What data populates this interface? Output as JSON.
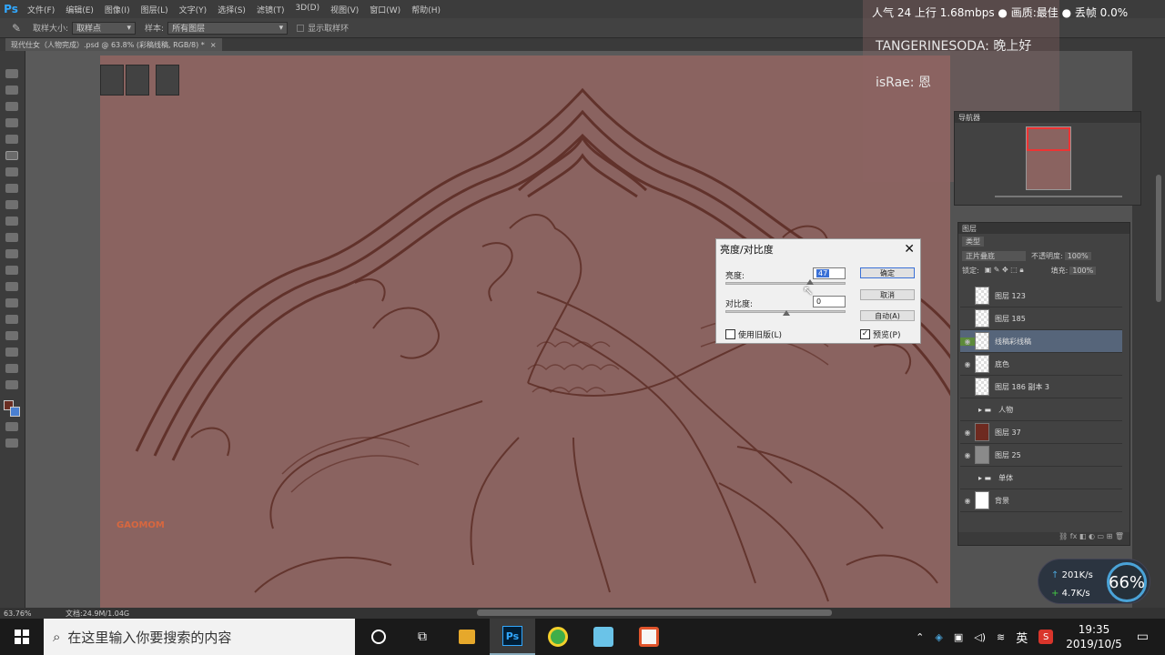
{
  "app": {
    "logo": "Ps"
  },
  "menu": [
    "文件(F)",
    "编辑(E)",
    "图像(I)",
    "图层(L)",
    "文字(Y)",
    "选择(S)",
    "滤镜(T)",
    "3D(D)",
    "视图(V)",
    "窗口(W)",
    "帮助(H)"
  ],
  "options": {
    "size_label": "取样大小:",
    "size_value": "取样点",
    "sample_label": "样本:",
    "sample_value": "所有图层",
    "ring_label": "显示取样环"
  },
  "doc_tab": "现代仕女（人物完成）.psd @ 63.8% (彩稿线稿, RGB/8) *",
  "stream": {
    "top": "人气 24    上行 1.68mbps  ● 画质:最佳  ● 丢帧 0.0%",
    "chats": [
      {
        "user": "TANGERINESODA:",
        "text": "晚上好"
      },
      {
        "user": "isRae:",
        "text": "恩"
      }
    ]
  },
  "navigator": {
    "title": "导航器"
  },
  "layers_panel": {
    "title": "图层",
    "filter": "类型",
    "blend": "正片叠底",
    "opacity_label": "不透明度:",
    "opacity": "100%",
    "lock_label": "锁定:",
    "fill_label": "填充:",
    "fill": "100%",
    "layers": [
      {
        "name": "图层 123",
        "visible": false,
        "selected": false,
        "type": "layer"
      },
      {
        "name": "图层 185",
        "visible": false,
        "selected": false,
        "type": "layer"
      },
      {
        "name": "线稿彩线稿",
        "visible": true,
        "selected": true,
        "type": "layer"
      },
      {
        "name": "底色",
        "visible": true,
        "selected": false,
        "type": "layer"
      },
      {
        "name": "图层 186 副本 3",
        "visible": false,
        "selected": false,
        "type": "layer"
      },
      {
        "name": "人物",
        "visible": false,
        "selected": false,
        "type": "group"
      },
      {
        "name": "图层 37",
        "visible": true,
        "selected": false,
        "type": "fill-red"
      },
      {
        "name": "图层 25",
        "visible": true,
        "selected": false,
        "type": "fill-gray"
      },
      {
        "name": "单体",
        "visible": false,
        "selected": false,
        "type": "group"
      },
      {
        "name": "背景",
        "visible": true,
        "selected": false,
        "type": "fill-white"
      }
    ]
  },
  "dialog": {
    "title": "亮度/对比度",
    "brightness_label": "亮度:",
    "brightness_value": "47",
    "contrast_label": "对比度:",
    "contrast_value": "0",
    "ok": "确定",
    "cancel": "取消",
    "auto": "自动(A)",
    "legacy": "使用旧版(L)",
    "preview": "预览(P)"
  },
  "status": {
    "zoom": "63.76%",
    "doc": "文档:24.9M/1.04G"
  },
  "watermark": "GAOMOM",
  "taskbar": {
    "search_placeholder": "在这里输入你要搜索的内容",
    "time": "19:35",
    "date": "2019/10/5",
    "ime": "英"
  },
  "netwidget": {
    "up": "201K/s",
    "down": "4.7K/s",
    "percent": "66%"
  }
}
